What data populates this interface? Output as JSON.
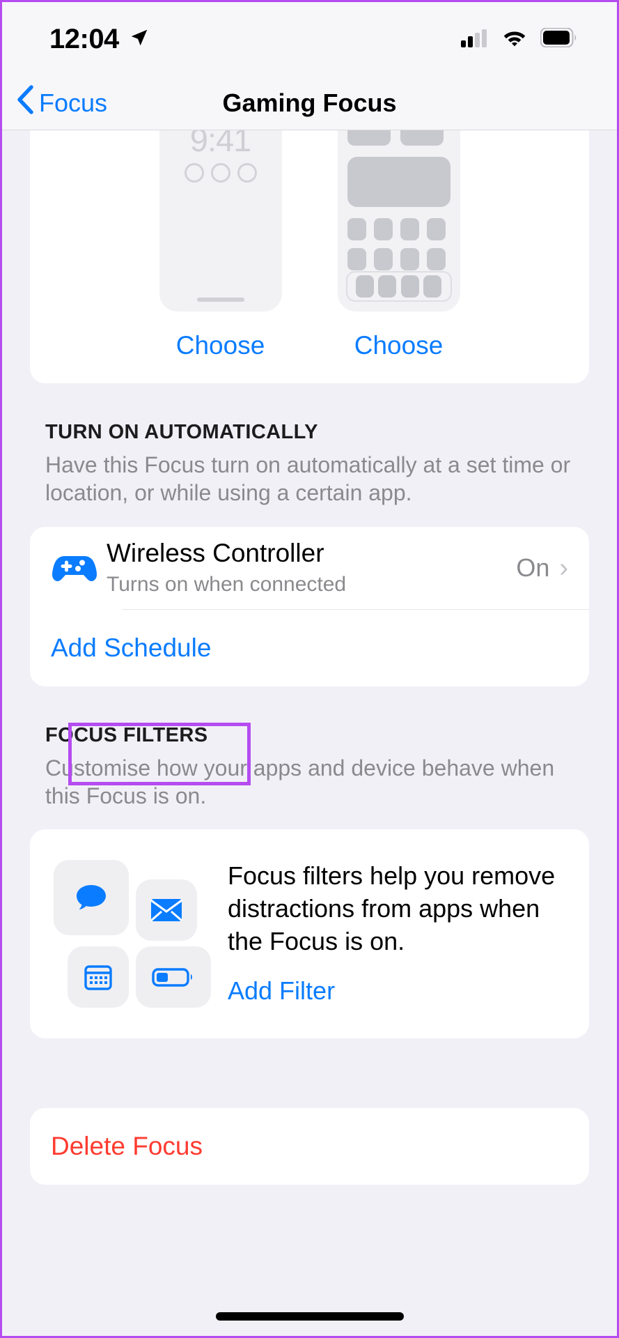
{
  "status_bar": {
    "time": "12:04",
    "location_icon": "location-arrow-icon",
    "cellular_icon": "cellular-signal-icon",
    "wifi_icon": "wifi-icon",
    "battery_icon": "battery-icon"
  },
  "nav": {
    "back_label": "Focus",
    "back_icon": "chevron-left-icon",
    "title": "Gaming Focus"
  },
  "previews": {
    "lock_screen": {
      "time": "9:41",
      "choose_label": "Choose"
    },
    "home_screen": {
      "choose_label": "Choose"
    }
  },
  "turn_on_automatically": {
    "header": "TURN ON AUTOMATICALLY",
    "description": "Have this Focus turn on automatically at a set time or location, or while using a certain app.",
    "rows": [
      {
        "icon": "game-controller-icon",
        "title": "Wireless Controller",
        "subtitle": "Turns on when connected",
        "value": "On",
        "chevron": "›"
      }
    ],
    "add_schedule_label": "Add Schedule"
  },
  "focus_filters": {
    "header": "FOCUS FILTERS",
    "description": "Customise how your apps and device behave when this Focus is on.",
    "promo_text": "Focus filters help you remove distractions from apps when the Focus is on.",
    "add_filter_label": "Add Filter",
    "tiles": [
      {
        "icon": "message-bubble-icon"
      },
      {
        "icon": "mail-envelope-icon"
      },
      {
        "icon": "calendar-icon"
      },
      {
        "icon": "low-power-battery-icon"
      }
    ]
  },
  "delete": {
    "label": "Delete Focus"
  },
  "colors": {
    "accent_blue": "#0a7cff",
    "destructive_red": "#ff3b30",
    "annotation_purple": "#b44cf0",
    "page_background": "#f2f0f7"
  }
}
